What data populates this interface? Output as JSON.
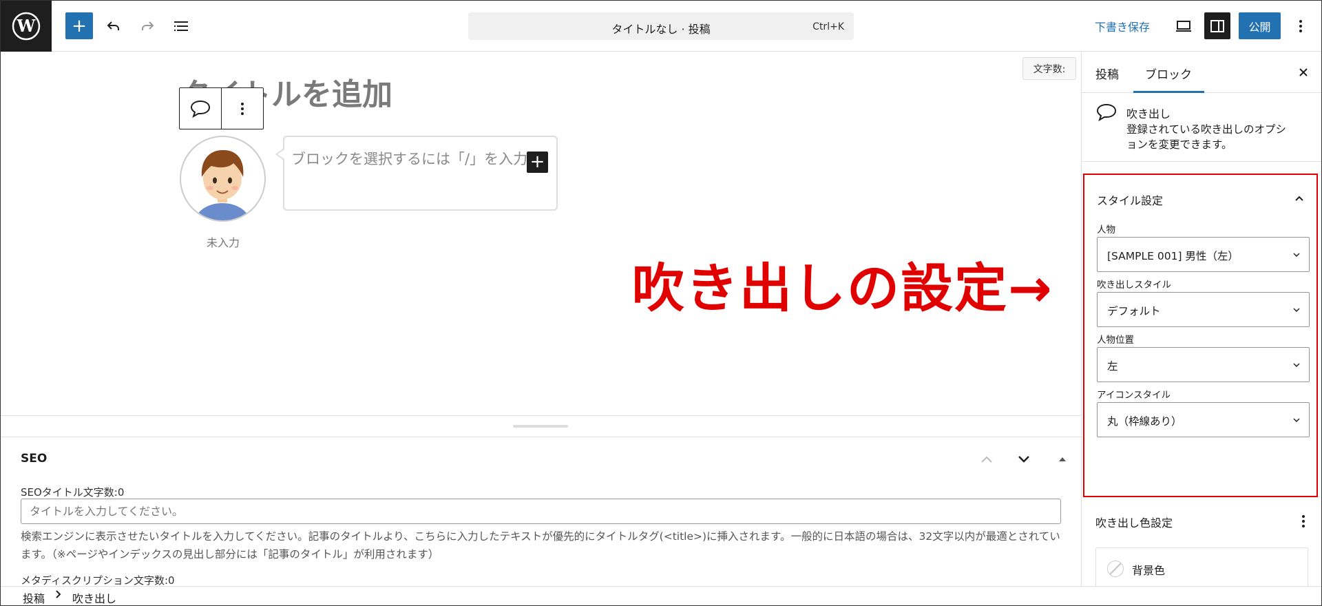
{
  "colors": {
    "accent": "#2271b1",
    "dark": "#1e1e1e",
    "annotation": "#e00000"
  },
  "toolbar": {
    "logo_icon": "wordpress-logo-icon",
    "inserter_label": "+",
    "command_title": "タイトルなし · 投稿",
    "command_shortcut": "Ctrl+K",
    "save_draft_label": "下書き保存",
    "publish_label": "公開"
  },
  "canvas": {
    "word_count_label": "文字数:",
    "title_placeholder": "タイトルを追加",
    "bubble_placeholder": "ブロックを選択するには「/」を入力",
    "avatar_name": "未入力",
    "quick_insert_label": "+",
    "annotation_text": "吹き出しの設定→"
  },
  "seo": {
    "title": "SEO",
    "title_label": "SEOタイトル文字数:0",
    "title_placeholder": "タイトルを入力してください。",
    "title_help": "検索エンジンに表示させたいタイトルを入力してください。記事のタイトルより、こちらに入力したテキストが優先的にタイトルタグ(<title>)に挿入されます。一般的に日本語の場合は、32文字以内が最適とされています。（※ページやインデックスの見出し部分には「記事のタイトル」が利用されます）",
    "meta_label": "メタディスクリプション文字数:0"
  },
  "breadcrumb": {
    "items": [
      "投稿",
      "吹き出し"
    ]
  },
  "sidebar": {
    "tabs": [
      {
        "label": "投稿"
      },
      {
        "label": "ブロック"
      }
    ],
    "block": {
      "name": "吹き出し",
      "description": "登録されている吹き出しのオプションを変更できます。"
    },
    "style_panel": {
      "title": "スタイル設定",
      "fields": [
        {
          "label": "人物",
          "value": "[SAMPLE 001] 男性（左）"
        },
        {
          "label": "吹き出しスタイル",
          "value": "デフォルト"
        },
        {
          "label": "人物位置",
          "value": "左"
        },
        {
          "label": "アイコンスタイル",
          "value": "丸（枠線あり）"
        }
      ]
    },
    "color_panel": {
      "title": "吹き出し色設定",
      "items": [
        {
          "label": "背景色"
        }
      ]
    }
  }
}
